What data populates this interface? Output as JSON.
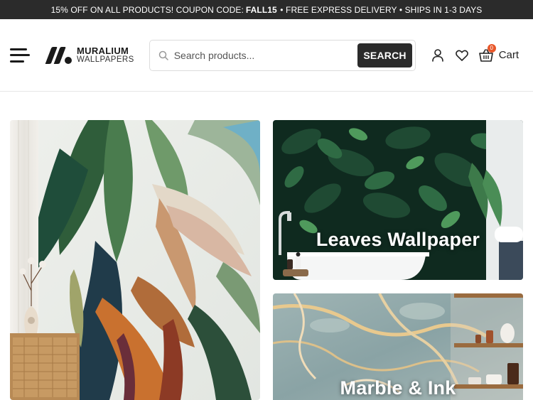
{
  "promo": {
    "prefix": "15% OFF ON ALL PRODUCTS! COUPON CODE:",
    "code": "FALL15",
    "suffix": "• FREE EXPRESS DELIVERY • SHIPS IN 1-3 DAYS"
  },
  "header": {
    "logo": {
      "line1": "MURALIUM",
      "line2": "WALLPAPERS"
    },
    "search": {
      "placeholder": "Search products...",
      "button_label": "SEARCH"
    },
    "icons": [
      "user-icon",
      "heart-icon",
      "basket-icon"
    ],
    "cart": {
      "count": "0",
      "label": "Cart"
    }
  },
  "categories": [
    {
      "title": ""
    },
    {
      "title": "Leaves Wallpaper"
    },
    {
      "title": "Marble & Ink"
    }
  ],
  "colors": {
    "topbar": "#2b2b2b",
    "search_button": "#2b2b2b",
    "cart_badge": "#e8572a"
  }
}
